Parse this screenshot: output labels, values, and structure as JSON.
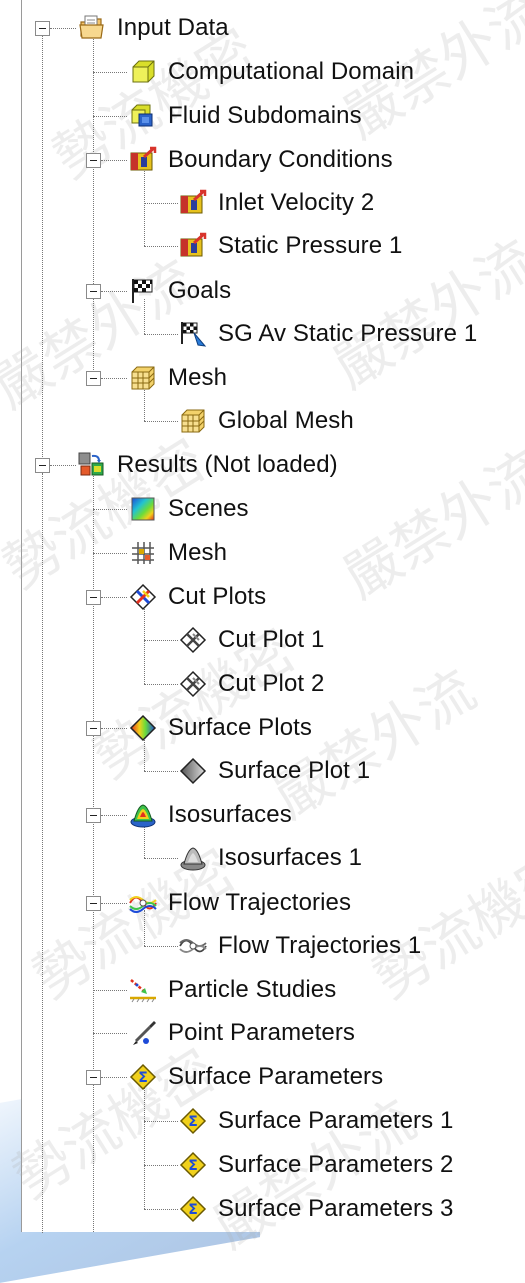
{
  "tree": {
    "input_data": {
      "label": "Input Data",
      "children": {
        "computational_domain": "Computational Domain",
        "fluid_subdomains": "Fluid Subdomains",
        "boundary_conditions": {
          "label": "Boundary Conditions",
          "children": [
            "Inlet Velocity 2",
            "Static Pressure 1"
          ]
        },
        "goals": {
          "label": "Goals",
          "children": [
            "SG Av Static Pressure 1"
          ]
        },
        "mesh": {
          "label": "Mesh",
          "children": [
            "Global Mesh"
          ]
        }
      }
    },
    "results": {
      "label": "Results (Not loaded)",
      "children": {
        "scenes": "Scenes",
        "mesh": "Mesh",
        "cut_plots": {
          "label": "Cut Plots",
          "children": [
            "Cut Plot 1",
            "Cut Plot 2"
          ]
        },
        "surface_plots": {
          "label": "Surface Plots",
          "children": [
            "Surface Plot 1"
          ]
        },
        "isosurfaces": {
          "label": "Isosurfaces",
          "children": [
            "Isosurfaces 1"
          ]
        },
        "flow_trajectories": {
          "label": "Flow Trajectories",
          "children": [
            "Flow Trajectories 1"
          ]
        },
        "particle_studies": "Particle Studies",
        "point_parameters": "Point Parameters",
        "surface_parameters": {
          "label": "Surface Parameters",
          "children": [
            "Surface Parameters 1",
            "Surface Parameters 2",
            "Surface Parameters 3"
          ]
        }
      }
    }
  },
  "watermark": {
    "text_a": "嚴禁外流",
    "text_b": "勢流機密"
  },
  "colors": {
    "tree_line": "#777777",
    "text": "#111111",
    "accent_blue": "#2f7fd6"
  }
}
